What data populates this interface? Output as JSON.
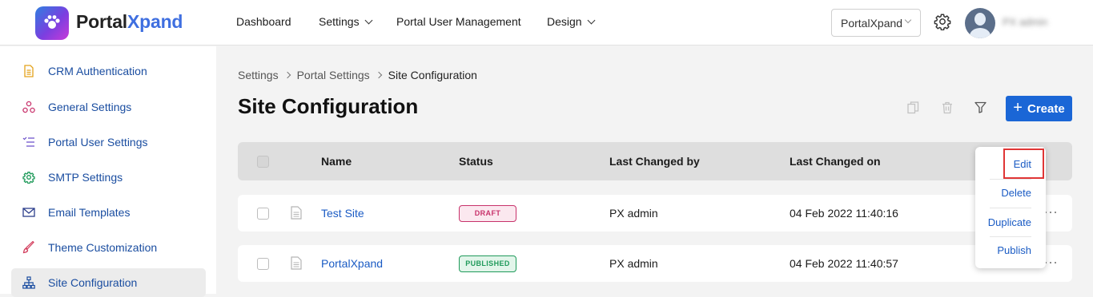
{
  "brand": {
    "name_part1": "Portal",
    "name_part2": "Xpand"
  },
  "nav": {
    "dashboard": "Dashboard",
    "settings": "Settings",
    "portal_user_management": "Portal User Management",
    "design": "Design"
  },
  "portal_select": {
    "value": "PortalXpand"
  },
  "user": {
    "name": "PX admin"
  },
  "sidebar": {
    "items": [
      {
        "label": "CRM Authentication",
        "icon": "document-icon"
      },
      {
        "label": "General Settings",
        "icon": "nodes-icon"
      },
      {
        "label": "Portal User Settings",
        "icon": "list-icon"
      },
      {
        "label": "SMTP Settings",
        "icon": "gear-icon"
      },
      {
        "label": "Email Templates",
        "icon": "mail-icon"
      },
      {
        "label": "Theme Customization",
        "icon": "brush-icon"
      },
      {
        "label": "Site Configuration",
        "icon": "sitemap-icon"
      }
    ]
  },
  "breadcrumb": [
    "Settings",
    "Portal Settings",
    "Site Configuration"
  ],
  "page_title": "Site Configuration",
  "toolbar": {
    "create_label": "Create"
  },
  "table": {
    "columns": [
      "Name",
      "Status",
      "Last Changed by",
      "Last Changed on"
    ],
    "rows": [
      {
        "name": "Test Site",
        "status": "DRAFT",
        "changed_by": "PX admin",
        "changed_on": "04 Feb 2022 11:40:16"
      },
      {
        "name": "PortalXpand",
        "status": "PUBLISHED",
        "changed_by": "PX admin",
        "changed_on": "04 Feb 2022 11:40:57"
      }
    ]
  },
  "context_menu": {
    "items": [
      "Edit",
      "Delete",
      "Duplicate",
      "Publish"
    ]
  },
  "colors": {
    "accent": "#1a66d6",
    "draft": "#c8326b",
    "published": "#1f9a5a",
    "highlight": "#e03535"
  }
}
